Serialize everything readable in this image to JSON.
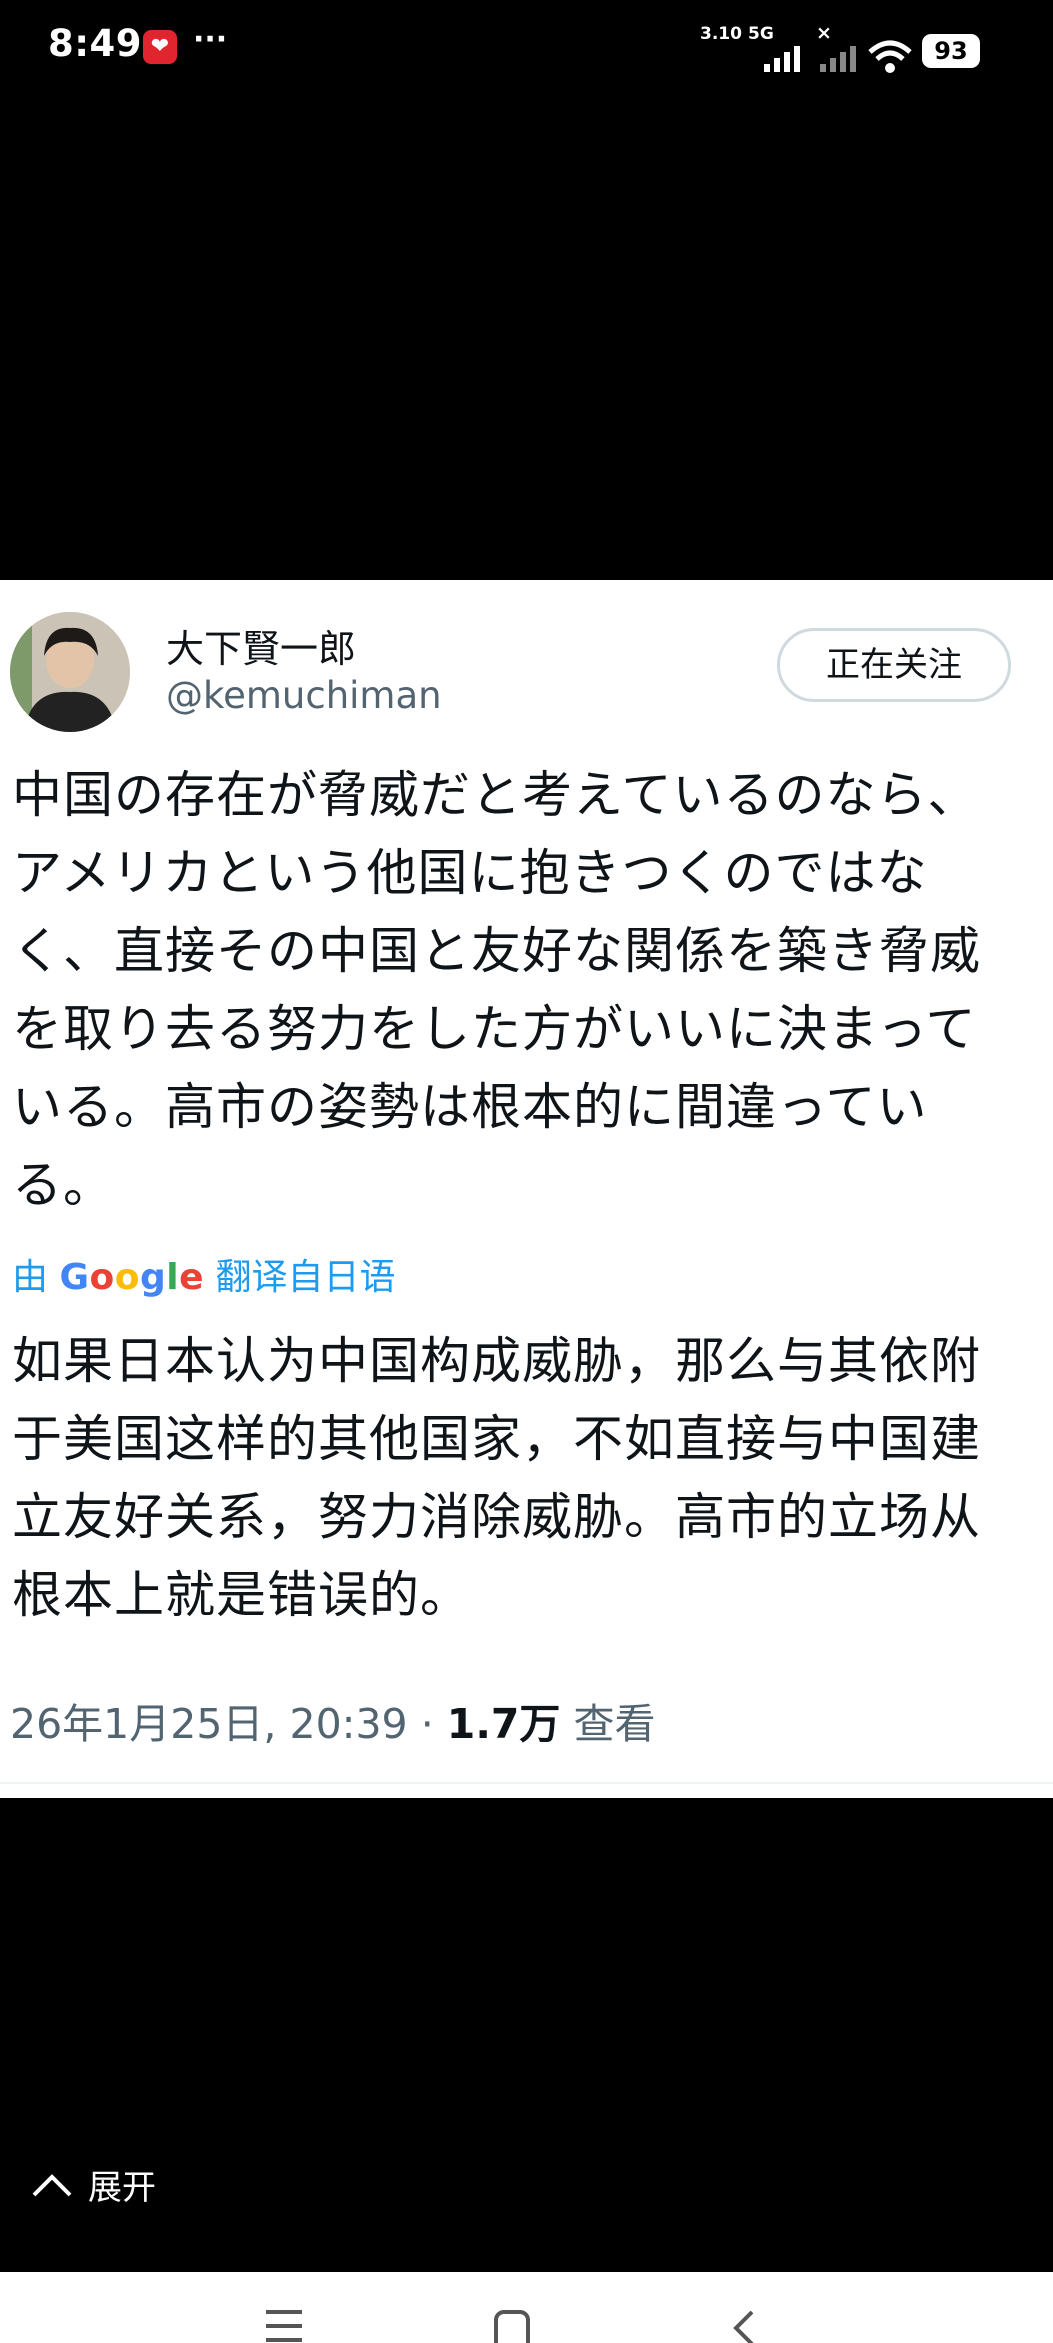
{
  "status_bar": {
    "time": "8:49",
    "more": "···",
    "net_speed": "3.10",
    "network": "5G",
    "battery": "93"
  },
  "tweet": {
    "display_name": "大下賢一郎",
    "handle": "@kemuchiman",
    "follow_label": "正在关注",
    "original_lines": [
      "中国の存在が脅威だと考えているのなら、",
      "アメリカという他国に抱きつくのではな",
      "く、直接その中国と友好な関係を築き脅威",
      "を取り去る努力をした方がいいに決まって",
      "いる。高市の姿勢は根本的に間違ってい",
      "る。"
    ],
    "translation_prefix": "由",
    "translation_provider": "Google",
    "translation_suffix": "翻译自日语",
    "translated_lines": [
      "如果日本认为中国构成威胁，那么与其依附",
      "于美国这样的其他国家，不如直接与中国建",
      "立友好关系，努力消除威胁。高市的立场从",
      "根本上就是错误的。"
    ],
    "timestamp": "26年1月25日, 20:39",
    "separator": "·",
    "views_count": "1.7万",
    "views_label": "查看"
  },
  "expand_label": "展开",
  "colors": {
    "link_blue": "#1d9bf0",
    "secondary_text": "#536471",
    "primary_text": "#0f1419"
  },
  "icons": [
    "app-badge-icon",
    "signal-icon",
    "wifi-icon",
    "chevron-up-icon",
    "menu-icon",
    "home-icon",
    "back-icon"
  ]
}
